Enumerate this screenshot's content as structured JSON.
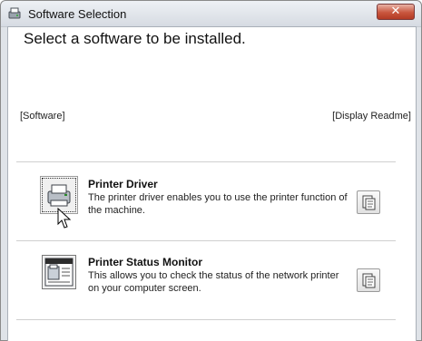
{
  "window": {
    "title": "Software Selection",
    "close_label": "✕"
  },
  "main": {
    "heading": "Select a software to be installed.",
    "software_header": "[Software]",
    "readme_header": "[Display Readme]"
  },
  "items": [
    {
      "title": "Printer Driver",
      "description": "The printer driver enables you to use the printer function of the machine.",
      "icon": "printer-icon"
    },
    {
      "title": "Printer Status Monitor",
      "description": "This allows you to check the status of the network printer on your computer screen.",
      "icon": "status-monitor-icon"
    }
  ]
}
